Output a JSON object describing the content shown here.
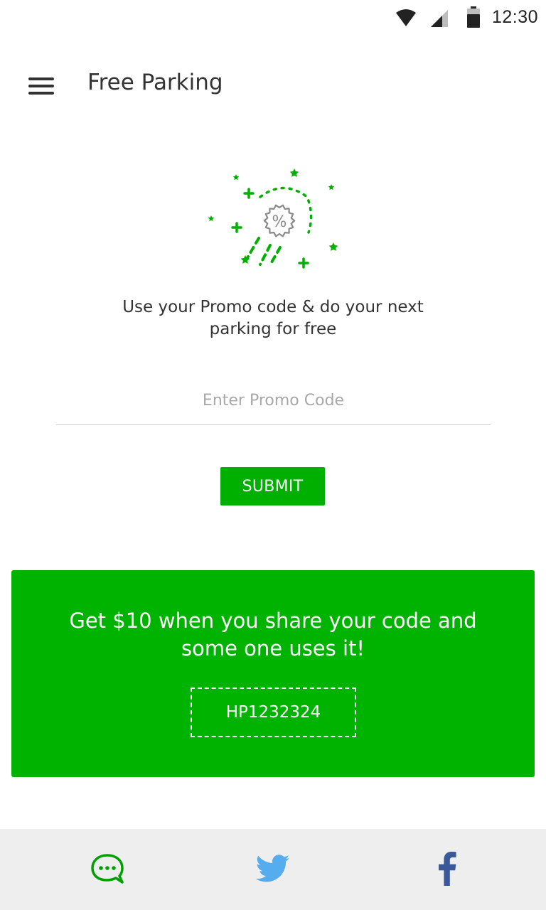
{
  "status_bar": {
    "time": "12:30",
    "icons": [
      "wifi-icon",
      "cell-signal-icon",
      "battery-icon"
    ]
  },
  "app_bar": {
    "title": "Free Parking",
    "menu_icon": "hamburger-menu-icon"
  },
  "promo": {
    "illustration_icon": "percent-badge-celebration-icon",
    "description_line1": "Use your Promo code & do your next",
    "description_line2": "parking for free",
    "input_placeholder": "Enter Promo Code",
    "input_value": "",
    "submit_label": "SUBMIT"
  },
  "referral": {
    "text_line1": "Get $10 when you share your code and",
    "text_line2": "some one uses it!",
    "code": "HP1232324"
  },
  "share": {
    "items": [
      {
        "icon": "message-icon",
        "color": "#00a000"
      },
      {
        "icon": "twitter-icon",
        "color": "#55acee"
      },
      {
        "icon": "facebook-icon",
        "color": "#3b5998"
      }
    ]
  },
  "colors": {
    "accent": "#00b000",
    "text": "#333333",
    "placeholder": "#a8a8a8",
    "share_bar_bg": "#eeeeee"
  }
}
